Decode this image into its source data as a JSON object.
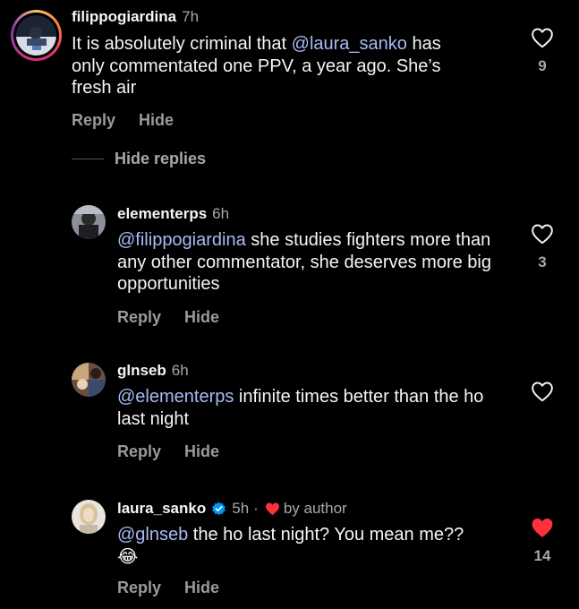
{
  "comments": [
    {
      "username": "filippogiardina",
      "time": "7h",
      "text_parts": [
        "It is absolutely criminal that ",
        "@laura_sanko",
        " has only commentated one PPV, a year ago. She’s fresh air"
      ],
      "reply_label": "Reply",
      "hide_label": "Hide",
      "like_count": "9",
      "liked": false
    },
    {
      "username": "elementerps",
      "time": "6h",
      "text_parts": [
        "@filippogiardina",
        " she studies fighters more than any other commentator, she deserves more big opportunities"
      ],
      "reply_label": "Reply",
      "hide_label": "Hide",
      "like_count": "3",
      "liked": false
    },
    {
      "username": "glnseb",
      "time": "6h",
      "text_parts": [
        "@elementerps",
        " infinite times better than the ho last night"
      ],
      "reply_label": "Reply",
      "hide_label": "Hide",
      "like_count": "",
      "liked": false
    },
    {
      "username": "laura_sanko",
      "time": "5h",
      "dot": "·",
      "by_author": "by author",
      "verified": true,
      "text_parts": [
        "@glnseb",
        " the ho last night? You mean me??"
      ],
      "emoji": "😂",
      "reply_label": "Reply",
      "hide_label": "Hide",
      "like_count": "14",
      "liked": true
    }
  ],
  "hide_replies_label": "Hide replies",
  "colors": {
    "background": "#000000",
    "mention": "#a7bbf6",
    "muted": "#a8a8a8",
    "like_red": "#ff3040",
    "verified_blue": "#0095f6"
  },
  "icons": [
    "heart-outline-icon",
    "heart-filled-icon",
    "verified-badge-icon"
  ]
}
